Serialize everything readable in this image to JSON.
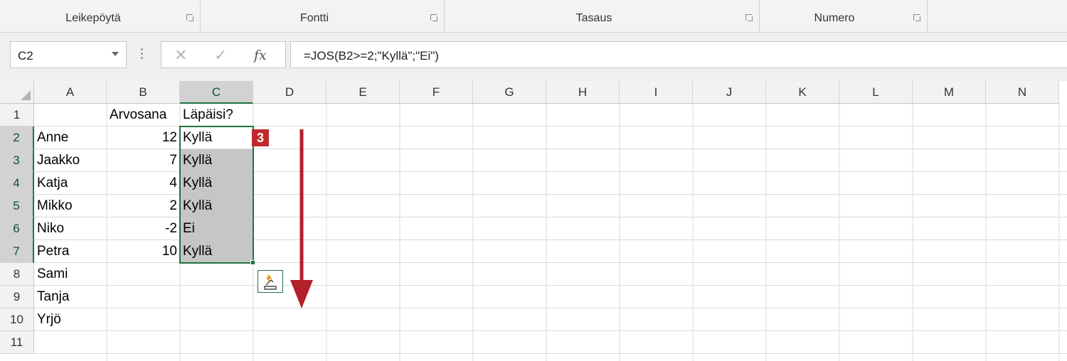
{
  "ribbon": {
    "groups": [
      {
        "label": "Leikepöytä"
      },
      {
        "label": "Fontti"
      },
      {
        "label": "Tasaus"
      },
      {
        "label": "Numero"
      }
    ]
  },
  "formula_bar": {
    "name_box": "C2",
    "cancel_icon": "✕",
    "enter_icon": "✓",
    "fx_label": "fx",
    "formula": "=JOS(B2>=2;\"Kyllä\";\"Ei\")"
  },
  "columns": [
    "A",
    "B",
    "C",
    "D",
    "E",
    "F",
    "G",
    "H",
    "I",
    "J",
    "K",
    "L",
    "M",
    "N"
  ],
  "rows": [
    "1",
    "2",
    "3",
    "4",
    "5",
    "6",
    "7",
    "8",
    "9",
    "10",
    "11"
  ],
  "cells": {
    "B1": "Arvosana",
    "C1": "Läpäisi?",
    "A2": "Anne",
    "B2": "12",
    "C2": "Kyllä",
    "A3": "Jaakko",
    "B3": "7",
    "C3": "Kyllä",
    "A4": "Katja",
    "B4": "4",
    "C4": "Kyllä",
    "A5": "Mikko",
    "B5": "2",
    "C5": "Kyllä",
    "A6": "Niko",
    "B6": "-2",
    "C6": "Ei",
    "A7": "Petra",
    "B7": "10",
    "C7": "Kyllä",
    "A8": "Sami",
    "A9": "Tanja",
    "A10": "Yrjö"
  },
  "callout": {
    "step_number": "3"
  },
  "colors": {
    "accent": "#217346",
    "callout": "#c0282d",
    "arrow": "#b3202a"
  }
}
